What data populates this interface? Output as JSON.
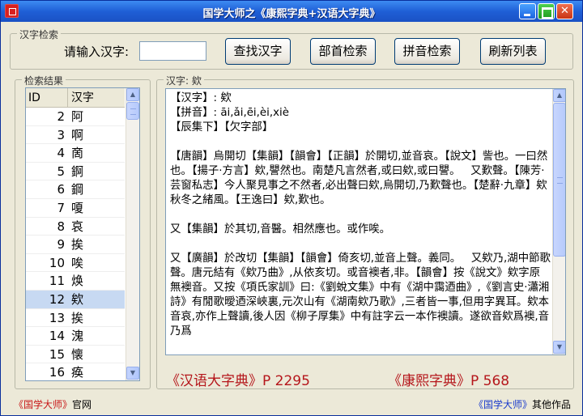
{
  "window": {
    "title": "国学大师之《康熙字典+汉语大字典》"
  },
  "search": {
    "group_title": "汉字检索",
    "input_label": "请输入汉字:",
    "input_value": "",
    "buttons": {
      "find": "查找汉字",
      "radical": "部首检索",
      "pinyin": "拼音检索",
      "refresh": "刷新列表"
    }
  },
  "results": {
    "group_title": "检索结果",
    "columns": [
      "ID",
      "汉字"
    ],
    "rows": [
      {
        "id": "2",
        "char": "阿"
      },
      {
        "id": "3",
        "char": "啊"
      },
      {
        "id": "4",
        "char": "啇"
      },
      {
        "id": "5",
        "char": "錒"
      },
      {
        "id": "6",
        "char": "鋼"
      },
      {
        "id": "7",
        "char": "嗄"
      },
      {
        "id": "8",
        "char": "哀"
      },
      {
        "id": "9",
        "char": "挨"
      },
      {
        "id": "10",
        "char": "唉"
      },
      {
        "id": "11",
        "char": "焕"
      },
      {
        "id": "12",
        "char": "欸"
      },
      {
        "id": "13",
        "char": "挨"
      },
      {
        "id": "14",
        "char": "溾"
      },
      {
        "id": "15",
        "char": "懐"
      },
      {
        "id": "16",
        "char": "痪"
      }
    ],
    "selected_id": "12"
  },
  "detail": {
    "group_title": "汉字: 欸",
    "text": "【汉字】: 欸\n【拼音】: āi,ǎi,ēi,èi,xiè\n【辰集下】【欠字部】\n\n【唐韻】烏開切【集韻】【韻會】【正韻】於開切,並音哀。【說文】訾也。一曰然也。【揚子·方言】欸,譻然也。南楚凡言然者,或曰欸,或曰譻。   又歎聲。【陳芳·芸窗私志】今人聚見事之不然者,必出聲曰欸,烏開切,乃歎聲也。【楚辭·九章】欸秋冬之緒風。【王逸曰】欸,歎也。\n\n又【集韻】於其切,音醫。相然應也。或作唉。\n\n又【廣韻】於改切【集韻】【韻會】倚亥切,並音上聲。義同。   又欸乃,湖中節歌聲。唐元結有《欸乃曲》,从依亥切。或音襖者,非。【韻會】按《說文》欸字原無襖音。又按《項氏家訓》曰:《劉蛻文集》中有《湖中靄迺曲》,《劉言史·瀟湘詩》有閒歌曖迺深峽裏,元次山有《湖南欸乃歌》,三者皆一事,但用字異耳。欸本音哀,亦作上聲讀,後人因《柳子厚集》中有註字云一本作襖讀。遂欲音欸爲襖,音乃爲"
  },
  "references": {
    "hanyu": "《汉语大字典》P 2295",
    "kangxi": "《康熙字典》P 568"
  },
  "footer": {
    "left_brand": "《国学大师》",
    "left_suffix": "官网",
    "right_brand": "《国学大师》",
    "right_suffix": "其他作品"
  },
  "colors": {
    "title_bar": "#1f5fd6",
    "reference_text": "#b5161b",
    "selected_row": "#c7d9f2"
  }
}
